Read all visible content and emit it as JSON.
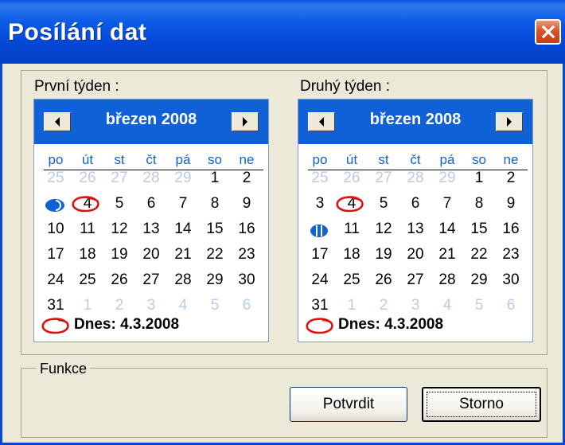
{
  "window": {
    "title": "Posílání dat",
    "close_icon": "close-icon"
  },
  "calendars": [
    {
      "label": "První týden :",
      "month_title": "březen 2008",
      "weekdays": [
        "po",
        "út",
        "st",
        "čt",
        "pá",
        "so",
        "ne"
      ],
      "weeks": [
        [
          "25",
          "26",
          "27",
          "28",
          "29",
          "1",
          "2"
        ],
        [
          "3",
          "4",
          "5",
          "6",
          "7",
          "8",
          "9"
        ],
        [
          "10",
          "11",
          "12",
          "13",
          "14",
          "15",
          "16"
        ],
        [
          "17",
          "18",
          "19",
          "20",
          "21",
          "22",
          "23"
        ],
        [
          "24",
          "25",
          "26",
          "27",
          "28",
          "29",
          "30"
        ],
        [
          "31",
          "1",
          "2",
          "3",
          "4",
          "5",
          "6"
        ]
      ],
      "today_text": "Dnes: 4.3.2008"
    },
    {
      "label": "Druhý týden :",
      "month_title": "březen 2008",
      "weekdays": [
        "po",
        "út",
        "st",
        "čt",
        "pá",
        "so",
        "ne"
      ],
      "weeks": [
        [
          "25",
          "26",
          "27",
          "28",
          "29",
          "1",
          "2"
        ],
        [
          "3",
          "4",
          "5",
          "6",
          "7",
          "8",
          "9"
        ],
        [
          "10",
          "11",
          "12",
          "13",
          "14",
          "15",
          "16"
        ],
        [
          "17",
          "18",
          "19",
          "20",
          "21",
          "22",
          "23"
        ],
        [
          "24",
          "25",
          "26",
          "27",
          "28",
          "29",
          "30"
        ],
        [
          "31",
          "1",
          "2",
          "3",
          "4",
          "5",
          "6"
        ]
      ],
      "today_text": "Dnes: 4.3.2008"
    }
  ],
  "funkce": {
    "label": "Funkce",
    "confirm_label": "Potvrdit",
    "cancel_label": "Storno"
  },
  "colors": {
    "header_blue": "#1060d8",
    "today_circle": "#e01010",
    "weekday": "#1461d0",
    "other_month": "#bccbe8"
  }
}
